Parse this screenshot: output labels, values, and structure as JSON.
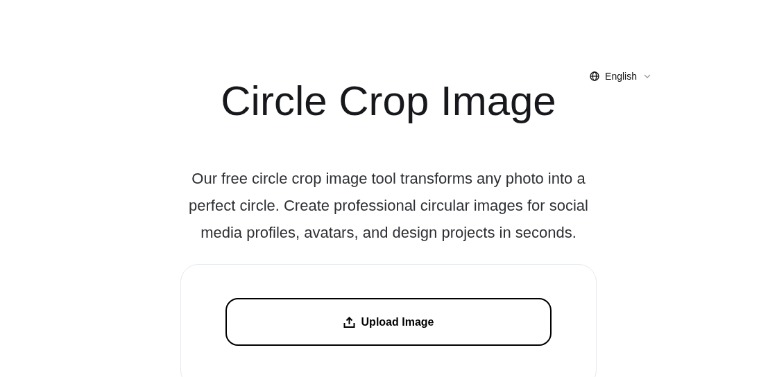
{
  "language_selector": {
    "label": "English"
  },
  "title": "Circle Crop Image",
  "description": "Our free circle crop image tool transforms any photo into a perfect circle. Create professional circular images for social media profiles, avatars, and design projects in seconds.",
  "upload_button": {
    "label": "Upload Image"
  }
}
